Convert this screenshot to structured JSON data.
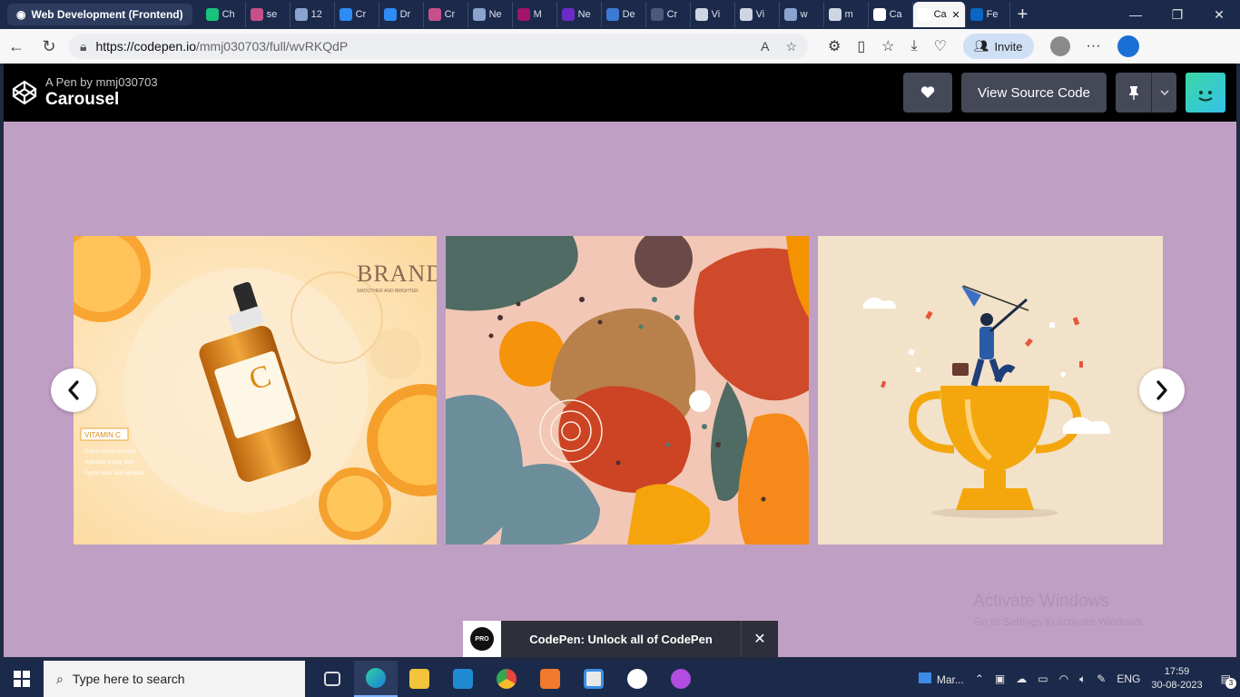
{
  "browser": {
    "tab_group": "Web Development (Frontend)",
    "tabs": [
      {
        "label": "Ch",
        "icon": "chatgpt-icon",
        "color": "#19c37d"
      },
      {
        "label": "se",
        "icon": "youtube-icon",
        "color": "#c8508a"
      },
      {
        "label": "12",
        "icon": "document-icon",
        "color": "#8aa4cf"
      },
      {
        "label": "Cr",
        "icon": "cn-icon",
        "color": "#2e8af5"
      },
      {
        "label": "Dr",
        "icon": "cn-icon",
        "color": "#2e8af5"
      },
      {
        "label": "Cr",
        "icon": "youtube-icon",
        "color": "#c8508a"
      },
      {
        "label": "Ne",
        "icon": "document-icon",
        "color": "#8aa4cf"
      },
      {
        "label": "M",
        "icon": "netflix-icon",
        "color": "#a3146b"
      },
      {
        "label": "Ne",
        "icon": "netflix-icon",
        "color": "#6a2cc4"
      },
      {
        "label": "De",
        "icon": "monitor-icon",
        "color": "#3b7bd4"
      },
      {
        "label": "Cr",
        "icon": "page-icon",
        "color": "#4a5a7a"
      },
      {
        "label": "Vi",
        "icon": "google-icon",
        "color": "#cfd6e3"
      },
      {
        "label": "Vi",
        "icon": "google-icon",
        "color": "#cfd6e3"
      },
      {
        "label": "w",
        "icon": "document-icon",
        "color": "#8aa4cf"
      },
      {
        "label": "m",
        "icon": "github-icon",
        "color": "#cfd6e3"
      },
      {
        "label": "Ca",
        "icon": "codepen-icon",
        "color": "#ffffff"
      },
      {
        "label": "Ca",
        "icon": "codepen-icon",
        "color": "#ffffff",
        "active": true
      },
      {
        "label": "Fe",
        "icon": "linkedin-icon",
        "color": "#0a66c2"
      }
    ],
    "url_host": "https://codepen.io",
    "url_path": "/mmj030703/full/wvRKQdP",
    "invite_label": "Invite"
  },
  "codepen": {
    "by_line": "A Pen by mmj030703",
    "title": "Carousel",
    "view_source_label": "View Source Code",
    "promo_text": "CodePen: Unlock all of CodePen",
    "promo_badge": "PRO"
  },
  "carousel": {
    "background": "#c09fc4",
    "slides": [
      {
        "name": "vitamin-c-serum-ad",
        "brand": "BRAND",
        "tagline": "SMOOTHER AND BRIGHTER",
        "badge": "VITAMIN C",
        "bottle_letter": "C",
        "bullets": [
          "Calms down sunburn",
          "Hydrates thirsty skin",
          "Fights lines and wrinkles"
        ]
      },
      {
        "name": "abstract-pattern"
      },
      {
        "name": "trophy-illustration"
      }
    ]
  },
  "watermark": {
    "line1": "Activate Windows",
    "line2": "Go to Settings to activate Windows."
  },
  "taskbar": {
    "search_placeholder": "Type here to search",
    "weather": "Mar...",
    "lang": "ENG",
    "time": "17:59",
    "date": "30-08-2023",
    "notifications": "3"
  }
}
